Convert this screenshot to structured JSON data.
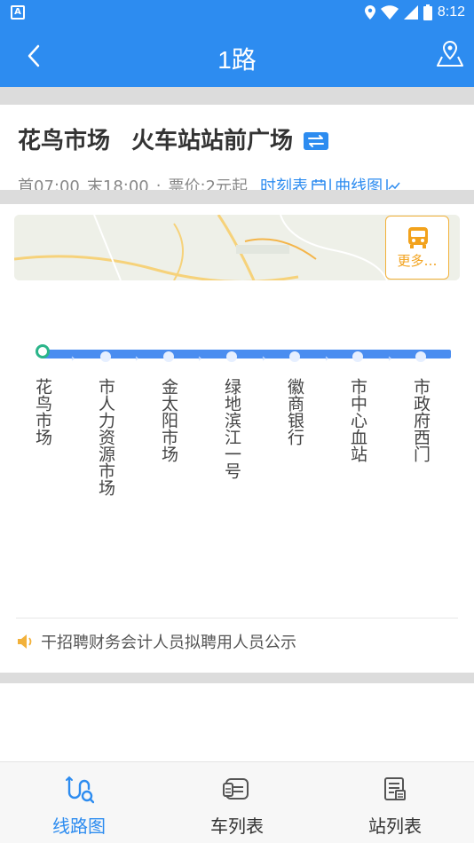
{
  "status_bar": {
    "time": "8:12"
  },
  "nav": {
    "title": "1路"
  },
  "route": {
    "start": "花鸟市场",
    "end": "火车站站前广场",
    "first_bus": "首07:00",
    "last_bus": "末18:00",
    "fare": "票价:2元起",
    "timetable_label": "时刻表",
    "separator": "|",
    "chart_label": "曲线图"
  },
  "map": {
    "more_label": "更多…"
  },
  "stations": [
    "花鸟市场",
    "市人力资源市场",
    "金太阳市场",
    "绿地滨江一号",
    "徽商银行",
    "市中心血站",
    "市政府西门"
  ],
  "notice": {
    "text": "干招聘财务会计人员拟聘用人员公示"
  },
  "tabs": [
    {
      "label": "线路图",
      "icon": "route-map-icon",
      "active": true
    },
    {
      "label": "车列表",
      "icon": "bus-list-icon",
      "active": false
    },
    {
      "label": "站列表",
      "icon": "station-list-icon",
      "active": false
    }
  ],
  "colors": {
    "primary": "#2d8cf0",
    "accent": "#f2a21c",
    "start_dot": "#2bb58a"
  }
}
